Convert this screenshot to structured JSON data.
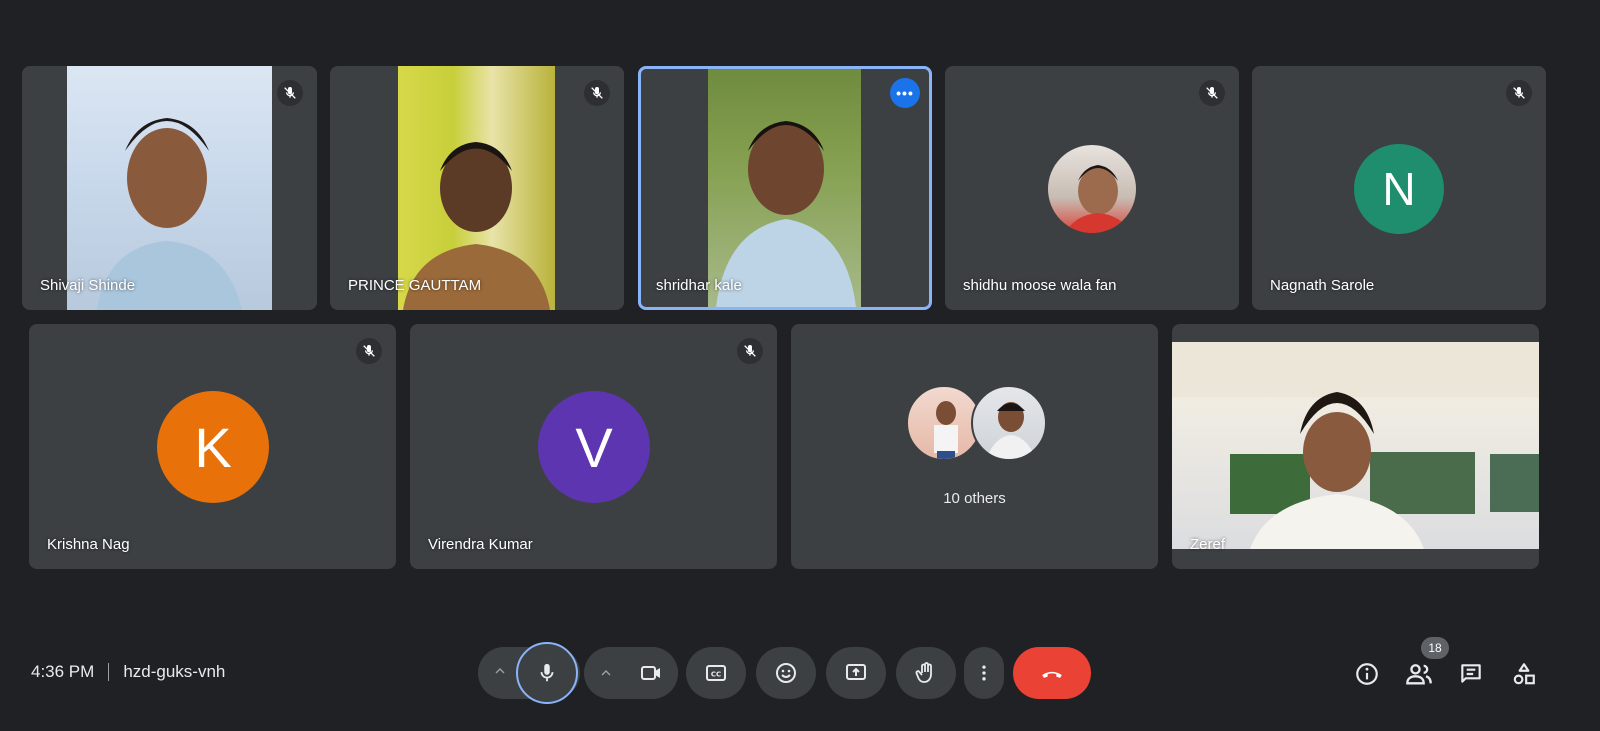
{
  "meeting": {
    "time": "4:36 PM",
    "code": "hzd-guks-vnh",
    "participant_count": "18"
  },
  "participants": [
    {
      "name": "Shivaji Shinde",
      "muted": true
    },
    {
      "name": "PRINCE GAUTTAM",
      "muted": true
    },
    {
      "name": "shridhar kale",
      "muted": false,
      "speaking": true
    },
    {
      "name": "shidhu moose wala fan",
      "muted": true
    },
    {
      "name": "Nagnath Sarole",
      "muted": true,
      "initial": "N",
      "color": "#1e8e6e"
    },
    {
      "name": "Krishna Nag",
      "muted": true,
      "initial": "K",
      "color": "#e8710a"
    },
    {
      "name": "Virendra Kumar",
      "muted": true,
      "initial": "V",
      "color": "#5e35b1"
    },
    {
      "name": "Zeref",
      "muted": false
    }
  ],
  "others": {
    "label": "10 others"
  },
  "icons": {
    "mute": "mic-off-icon",
    "more": "more-horiz-icon",
    "mic": "mic-icon",
    "camera": "videocam-icon",
    "captions": "closed-caption-icon",
    "emoji": "emoji-icon",
    "present": "present-screen-icon",
    "hand": "raise-hand-icon",
    "options": "more-vert-icon",
    "leave": "call-end-icon",
    "info": "info-icon",
    "people": "people-icon",
    "chat": "chat-icon",
    "activities": "activities-icon"
  },
  "colors": {
    "background": "#202124",
    "tile": "#3c4043",
    "accent": "#8ab4f8",
    "leave": "#ea4335",
    "speaking_indicator": "#1a73e8"
  }
}
